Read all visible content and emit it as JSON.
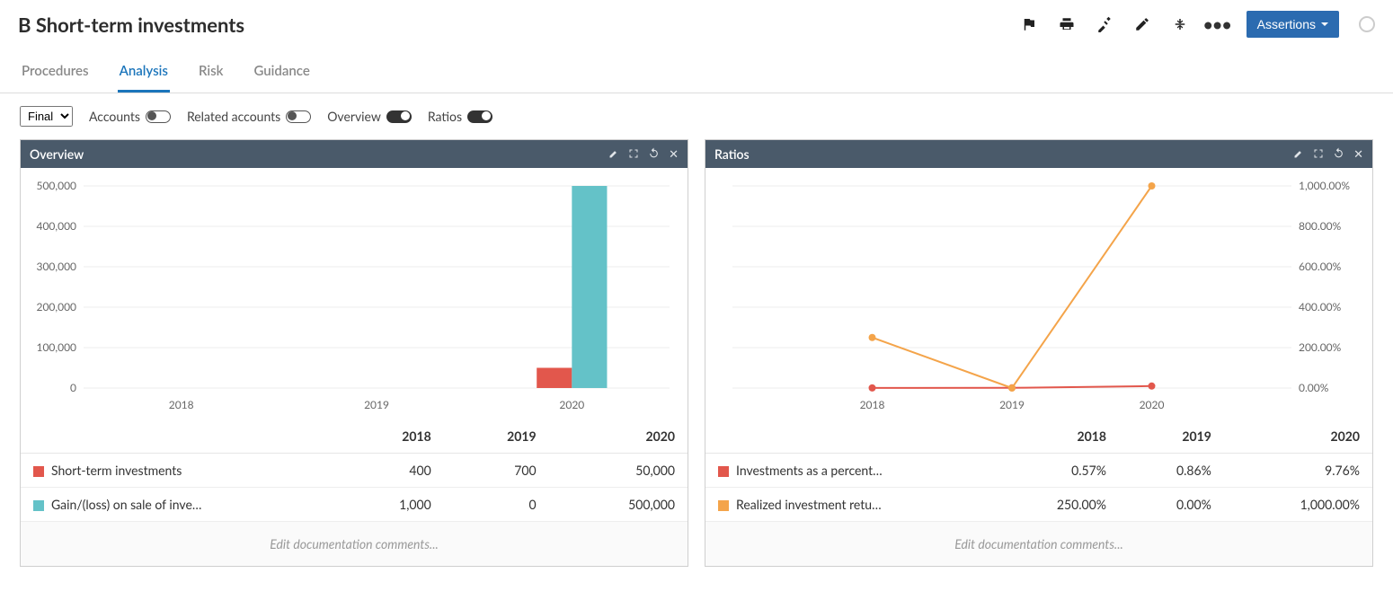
{
  "header": {
    "title": "B Short-term investments",
    "assertions_label": "Assertions"
  },
  "tabs": [
    {
      "label": "Procedures",
      "active": false
    },
    {
      "label": "Analysis",
      "active": true
    },
    {
      "label": "Risk",
      "active": false
    },
    {
      "label": "Guidance",
      "active": false
    }
  ],
  "controls": {
    "dropdown_value": "Final",
    "toggles": [
      {
        "label": "Accounts",
        "on": false
      },
      {
        "label": "Related accounts",
        "on": false
      },
      {
        "label": "Overview",
        "on": true
      },
      {
        "label": "Ratios",
        "on": true
      }
    ]
  },
  "panels": {
    "overview": {
      "title": "Overview",
      "edit_placeholder": "Edit documentation comments...",
      "years": [
        "2018",
        "2019",
        "2020"
      ],
      "series": [
        {
          "name": "Short-term investments",
          "color": "#e2574c",
          "values_display": [
            "400",
            "700",
            "50,000"
          ]
        },
        {
          "name": "Gain/(loss) on sale of inve…",
          "color": "#64c2c8",
          "values_display": [
            "1,000",
            "0",
            "500,000"
          ]
        }
      ]
    },
    "ratios": {
      "title": "Ratios",
      "edit_placeholder": "Edit documentation comments...",
      "years": [
        "2018",
        "2019",
        "2020"
      ],
      "series": [
        {
          "name": "Investments as a percent…",
          "color": "#e2574c",
          "values_display": [
            "0.57%",
            "0.86%",
            "9.76%"
          ]
        },
        {
          "name": "Realized investment retu…",
          "color": "#f4a44a",
          "values_display": [
            "250.00%",
            "0.00%",
            "1,000.00%"
          ]
        }
      ]
    }
  },
  "chart_data": [
    {
      "id": "overview",
      "type": "bar",
      "categories": [
        "2018",
        "2019",
        "2020"
      ],
      "series": [
        {
          "name": "Short-term investments",
          "color": "#e2574c",
          "values": [
            400,
            700,
            50000
          ]
        },
        {
          "name": "Gain/(loss) on sale of investments",
          "color": "#64c2c8",
          "values": [
            1000,
            0,
            500000
          ]
        }
      ],
      "ylim": [
        0,
        500000
      ],
      "yticks": [
        0,
        100000,
        200000,
        300000,
        400000,
        500000
      ],
      "ytick_labels": [
        "0",
        "100,000",
        "200,000",
        "300,000",
        "400,000",
        "500,000"
      ]
    },
    {
      "id": "ratios",
      "type": "line",
      "categories": [
        "2018",
        "2019",
        "2020"
      ],
      "series": [
        {
          "name": "Investments as a percentage",
          "color": "#e2574c",
          "values": [
            0.57,
            0.86,
            9.76
          ]
        },
        {
          "name": "Realized investment return",
          "color": "#f4a44a",
          "values": [
            250.0,
            0.0,
            1000.0
          ]
        }
      ],
      "ylim": [
        0,
        1000
      ],
      "yticks": [
        0,
        200,
        400,
        600,
        800,
        1000
      ],
      "ytick_labels": [
        "0.00%",
        "200.00%",
        "400.00%",
        "600.00%",
        "800.00%",
        "1,000.00%"
      ],
      "yaxis_position": "right"
    }
  ]
}
